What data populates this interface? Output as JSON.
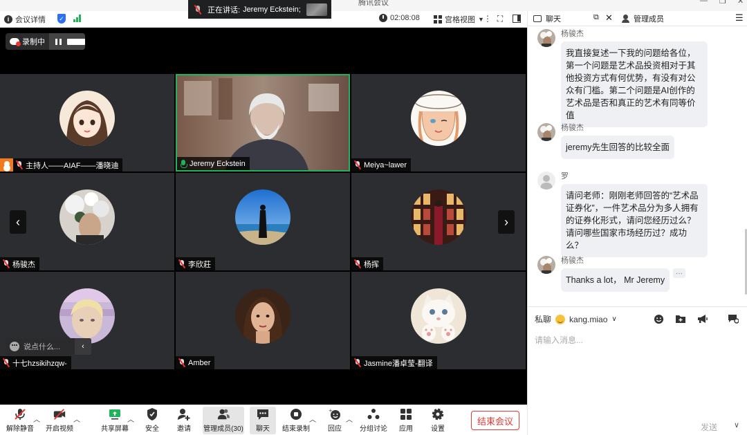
{
  "window": {
    "title": "腾讯会议",
    "minimize": "—",
    "restore": "❐",
    "close": "✕"
  },
  "meeting_bar": {
    "info_label": "会议详情",
    "timer": "02:08:08",
    "view_label": "宫格视图"
  },
  "speaking": {
    "prefix": "正在讲话:",
    "name": "Jeremy Eckstein;"
  },
  "recording": {
    "label": "录制中"
  },
  "participants": [
    {
      "name": "主持人——AIAF——潘晓迪",
      "mic": "off",
      "host": true,
      "kind": "avatar",
      "avatar": "anime-girl"
    },
    {
      "name": "Jeremy Eckstein",
      "mic": "on",
      "host": false,
      "kind": "video",
      "avatar": "video-feed"
    },
    {
      "name": "Meiya~lawer",
      "mic": "off",
      "host": false,
      "kind": "avatar",
      "avatar": "sketch-girl"
    },
    {
      "name": "杨骏杰",
      "mic": "off",
      "host": false,
      "kind": "avatar",
      "avatar": "flower-photo"
    },
    {
      "name": "李欣莊",
      "mic": "off",
      "host": false,
      "kind": "avatar",
      "avatar": "beach-photo"
    },
    {
      "name": "杨挥",
      "mic": "off",
      "host": false,
      "kind": "avatar",
      "avatar": "bookstore-photo"
    },
    {
      "name": "十七hzsikihzqw-",
      "mic": "off",
      "host": false,
      "kind": "avatar",
      "avatar": "blur-portrait"
    },
    {
      "name": "Amber",
      "mic": "off",
      "host": false,
      "kind": "avatar",
      "avatar": "woman-portrait"
    },
    {
      "name": "Jasmine潘卓莹-翻译",
      "mic": "off",
      "host": false,
      "kind": "avatar",
      "avatar": "kitten-photo"
    }
  ],
  "say_bar": {
    "placeholder": "说点什么..."
  },
  "toolbar": {
    "unmute": "解除静音",
    "start_video": "开启视频",
    "share_screen": "共享屏幕",
    "security": "安全",
    "invite": "邀请",
    "participants": "管理成员(30)",
    "chat": "聊天",
    "end_record": "结束录制",
    "reactions": "回应",
    "breakout": "分组讨论",
    "apps": "应用",
    "settings": "设置",
    "end_meeting": "结束会议"
  },
  "panel": {
    "chat_tab": "聊天",
    "members_tab": "管理成员"
  },
  "messages": [
    {
      "sender": "杨骏杰",
      "text": "我直接复述一下我的问题给各位，第一个问题是艺术品投资相对于其他投资方式有何优势，有没有对公众有门槛。第二个问题是AI创作的艺术品是否和真正的艺术有同等价值"
    },
    {
      "sender": "杨骏杰",
      "text": "jeremy先生回答的比较全面"
    },
    {
      "sender": "罗",
      "text": "请问老师：刚刚老师回答的“艺术品证券化”，一件艺术品分为多人拥有的证券化形式，请问您经历过么？请问哪些国家市场经历过？成功么？"
    },
    {
      "sender": "杨骏杰",
      "text": "Thanks a lot， Mr Jeremy"
    }
  ],
  "composer": {
    "to_label": "私聊",
    "to_name": "kang.miao",
    "placeholder": "请输入消息...",
    "send": "发送"
  },
  "colors": {
    "accent_green": "#1fb35c",
    "host_orange": "#f07a1d",
    "danger_red": "#e53935",
    "brand_blue": "#2f6ef5"
  }
}
